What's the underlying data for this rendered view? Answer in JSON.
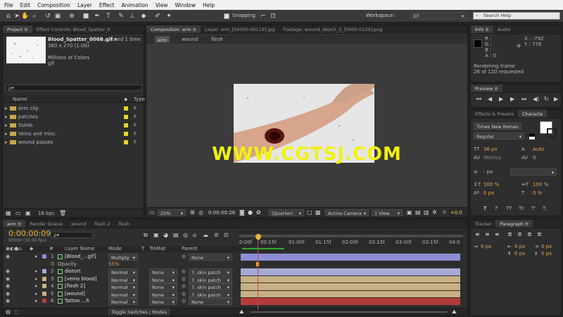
{
  "menu": [
    "File",
    "Edit",
    "Composition",
    "Layer",
    "Effect",
    "Animation",
    "View",
    "Window",
    "Help"
  ],
  "toolbar": {
    "snapping": "Snapping",
    "workspace_label": "Workspace:",
    "workspace_value": "DT",
    "search_placeholder": "Search Help"
  },
  "project": {
    "tabs": [
      "Project ≡",
      "Effect Controls: Blood_Spatter_0"
    ],
    "file_name": "Blood_Spatter_006B.gif ▾",
    "file_used": ", used 1 time",
    "file_dims": "360 x 270 (1.00)",
    "file_colors": "Millions of Colors",
    "file_type": "gif",
    "search_placeholder": "ρ▾",
    "col_name": "Name",
    "col_type": "Type",
    "items": [
      {
        "name": "Arm clip",
        "type": "F"
      },
      {
        "name": "patches",
        "type": "F"
      },
      {
        "name": "Solids",
        "type": "F"
      },
      {
        "name": "Veins and misc.",
        "type": "F"
      },
      {
        "name": "wound passes",
        "type": "F"
      }
    ],
    "bpc": "16 bpc"
  },
  "composition": {
    "tabs": [
      "Composition: arm ≡",
      "Layer: arm_[00000-00119].jpg",
      "Footage: wound_object_3_[0000-0120].png"
    ],
    "breadcrumbs": [
      "arm",
      "wound",
      "flesh"
    ],
    "watermark": "WWW.CGTSJ.COM",
    "zoom": "25%",
    "timecode": "0:00:00:26",
    "resolution": "(Quarter)",
    "camera": "Active Camera",
    "view": "1 View",
    "exposure": "+0.0"
  },
  "info": {
    "tabs": [
      "Info ≡",
      "Audio"
    ],
    "r": "R :",
    "g": "G :",
    "b": "B :",
    "a": "A : 0",
    "x": "X : -792",
    "y": "Y : 776",
    "status1": "Rendering frame",
    "status2": "26 of 120 requested"
  },
  "preview": {
    "tab": "Preview ≡"
  },
  "character": {
    "tabs": [
      "Effects & Presets",
      "Characte"
    ],
    "font": "Times New Roman",
    "style": "Regular",
    "size": "36 px",
    "leading": "Auto",
    "metrics": "Metrics",
    "tracking": "0",
    "stroke": "- px",
    "vscale": "100 %",
    "hscale": "100 %",
    "baseline": "0 px",
    "tsume": "0 %",
    "styles": [
      "T",
      "T",
      "TT",
      "Tt",
      "T'",
      "T,"
    ]
  },
  "paragraph": {
    "tabs": [
      "Tracker",
      "Paragraph ≡"
    ],
    "values": [
      "0 px",
      "0 px",
      "0 px",
      "0 px",
      "0 px"
    ]
  },
  "timeline": {
    "tabs": [
      "arm ≡",
      "Render Queue",
      "wound",
      "flesh 2",
      "flesh"
    ],
    "timecode": "0:00:00:09",
    "fps": "00009 (30.00 fps)",
    "search_placeholder": "ρ▾",
    "headers": {
      "num": "#",
      "name": "Layer Name",
      "mode": "Mode",
      "t": "T",
      "trkmat": "TrkMat",
      "parent": "Parent"
    },
    "ruler": [
      "0:00f",
      "00:15f",
      "01:00f",
      "01:15f",
      "02:00f",
      "02:15f",
      "03:00f",
      "03:15f",
      "04:0"
    ],
    "layers": [
      {
        "num": "1",
        "name": "[Blood_...gif]",
        "mode": "Multiply",
        "trkmat": "",
        "parent": "None",
        "color": "#8d8dd6"
      },
      {
        "num": "",
        "name": "Opacity",
        "mode": "55%",
        "trkmat": "",
        "parent": "",
        "color": ""
      },
      {
        "num": "2",
        "name": "distort",
        "mode": "Normal",
        "trkmat": "None",
        "parent": "7. skin patch",
        "color": "#a9a9d6"
      },
      {
        "num": "3",
        "name": "[veins blood]",
        "mode": "Normal",
        "trkmat": "None",
        "parent": "7. skin patch",
        "color": "#c7b185"
      },
      {
        "num": "4",
        "name": "[flesh 2]",
        "mode": "Normal",
        "trkmat": "None",
        "parent": "7. skin patch",
        "color": "#c7b185"
      },
      {
        "num": "5",
        "name": "[wound]",
        "mode": "Normal",
        "trkmat": "None",
        "parent": "7. skin patch",
        "color": "#c7b185"
      },
      {
        "num": "6",
        "name": "Tattoo ...h",
        "mode": "Normal",
        "trkmat": "None",
        "parent": "None",
        "color": "#b53b3b"
      }
    ],
    "toggle": "Toggle Switches / Modes"
  }
}
